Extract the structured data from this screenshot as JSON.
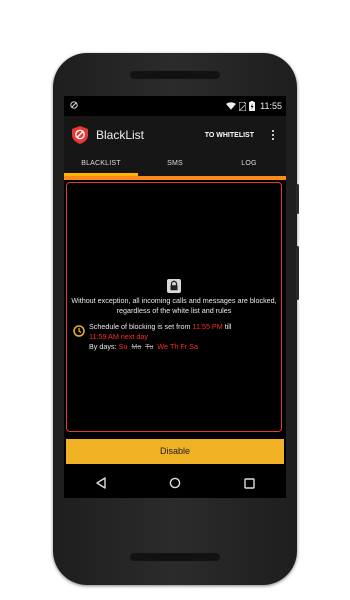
{
  "status_bar": {
    "time": "11:55",
    "icons": [
      "no-sim-icon",
      "wifi-icon",
      "sim-icon",
      "battery-icon"
    ]
  },
  "app_bar": {
    "title": "BlackList",
    "whitelist_label": "TO WHITELIST",
    "logo_icon": "blacklist-shield-icon",
    "menu_icon": "overflow-menu-icon"
  },
  "tabs": [
    {
      "label": "BLACKLIST",
      "selected": true
    },
    {
      "label": "SMS",
      "selected": false
    },
    {
      "label": "LOG",
      "selected": false
    }
  ],
  "content": {
    "lock_icon": "lock-icon",
    "message": "Without exception, all incoming calls and messages are blocked, regardless of the white list and rules",
    "schedule_prefix": "Schedule of blocking is set from ",
    "schedule_from": "11:55 PM",
    "schedule_till_word": " till",
    "schedule_to": "11:59 AM next day",
    "by_days_label": "By days: ",
    "days": [
      {
        "label": "Su",
        "active": true
      },
      {
        "label": "Mo",
        "active": false
      },
      {
        "label": "Tu",
        "active": false
      },
      {
        "label": "We",
        "active": true
      },
      {
        "label": "Th",
        "active": true
      },
      {
        "label": "Fr",
        "active": true
      },
      {
        "label": "Sa",
        "active": true
      }
    ]
  },
  "disable_button": "Disable",
  "nav": {
    "back_icon": "back-icon",
    "home_icon": "home-icon",
    "recents_icon": "recents-icon"
  },
  "colors": {
    "accent": "#ffb400",
    "highlight": "#ff2a2a",
    "button": "#f0b125",
    "border": "#e53935"
  }
}
